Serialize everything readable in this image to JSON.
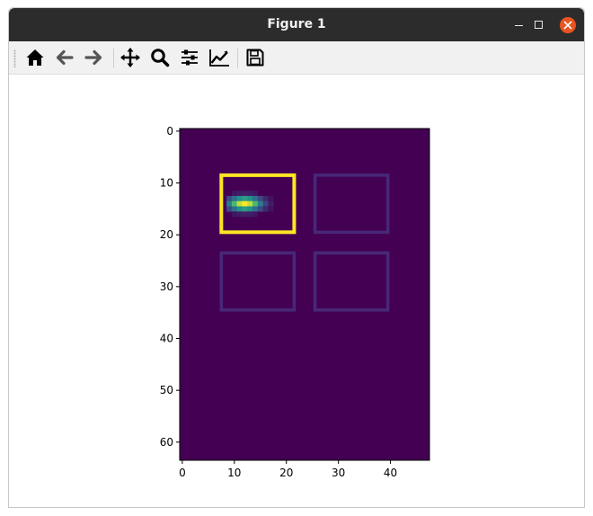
{
  "window": {
    "title": "Figure 1",
    "controls": [
      "minimize-icon",
      "maximize-icon",
      "close-icon"
    ],
    "close_color": "#e95420",
    "titlebar_color": "#2c2c2c"
  },
  "toolbar": {
    "buttons": [
      {
        "name": "home",
        "icon": "home-icon"
      },
      {
        "name": "back",
        "icon": "arrow-left-icon"
      },
      {
        "name": "forward",
        "icon": "arrow-right-icon"
      },
      {
        "name": "pan",
        "icon": "move-icon"
      },
      {
        "name": "zoom",
        "icon": "magnifier-icon"
      },
      {
        "name": "configure-subplots",
        "icon": "sliders-icon"
      },
      {
        "name": "edit-axes",
        "icon": "line-chart-icon"
      },
      {
        "name": "save",
        "icon": "floppy-disk-icon"
      }
    ]
  },
  "chart_data": {
    "type": "heatmap",
    "title": "",
    "xlabel": "",
    "ylabel": "",
    "shape": [
      64,
      48
    ],
    "colormap": "viridis",
    "background_color": "#440154",
    "xlim": [
      -0.5,
      47.5
    ],
    "ylim": [
      63.5,
      -0.5
    ],
    "x_ticks": [
      "0",
      "10",
      "20",
      "30",
      "40"
    ],
    "y_ticks": [
      "0",
      "10",
      "20",
      "30",
      "40",
      "50",
      "60"
    ],
    "hotspot": {
      "x_range": [
        9,
        19
      ],
      "y_range": [
        11,
        16
      ],
      "peak": [
        12,
        14
      ]
    },
    "regions": [
      {
        "name": "top-left",
        "x": [
          8,
          22
        ],
        "y": [
          9,
          19
        ],
        "color": "#fde725",
        "active": true
      },
      {
        "name": "top-right",
        "x": [
          26,
          40
        ],
        "y": [
          9,
          19
        ],
        "color": "#482878",
        "active": false
      },
      {
        "name": "bottom-left",
        "x": [
          8,
          22
        ],
        "y": [
          24,
          34
        ],
        "color": "#482878",
        "active": false
      },
      {
        "name": "bottom-right",
        "x": [
          26,
          40
        ],
        "y": [
          24,
          34
        ],
        "color": "#482878",
        "active": false
      }
    ]
  }
}
